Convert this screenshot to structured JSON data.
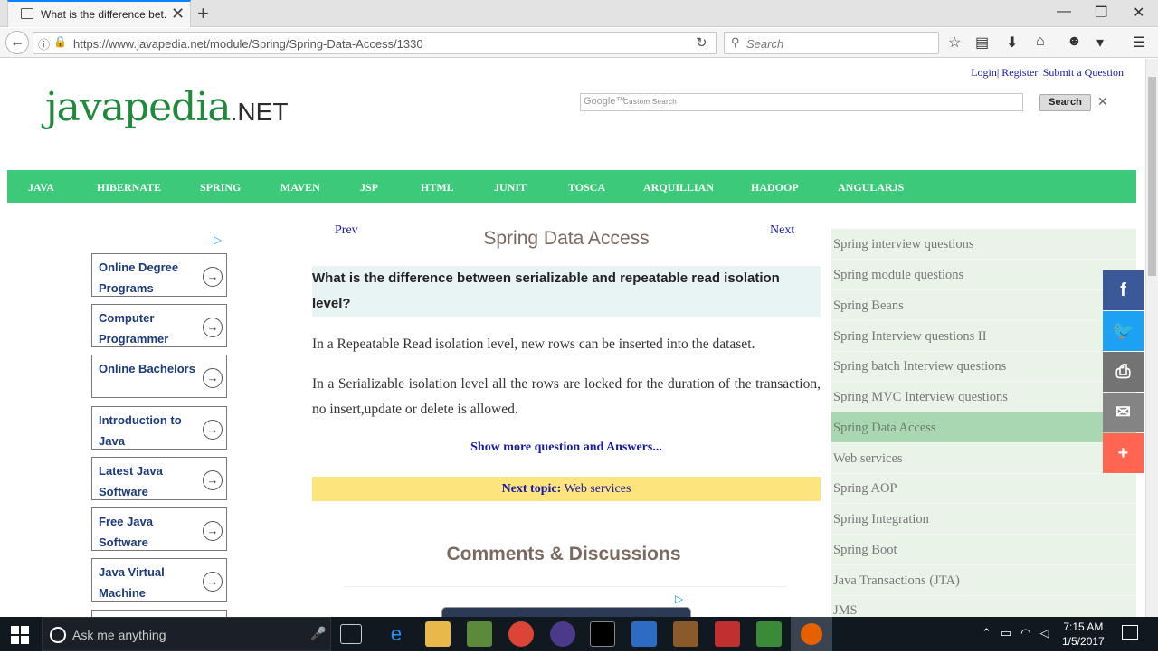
{
  "browser": {
    "tab_title": "What is the difference bet...",
    "url": "https://www.javapedia.net/module/Spring/Spring-Data-Access/1330",
    "search_placeholder": "Search"
  },
  "header": {
    "logo_main": "javapedia",
    "logo_suffix": ".NET",
    "links": "Login| Register| Submit a Question",
    "google_label": "Google™",
    "custom_search": "Custom Search",
    "search_button": "Search"
  },
  "nav": [
    "JAVA",
    "HIBERNATE",
    "SPRING",
    "MAVEN",
    "JSP",
    "HTML",
    "JUNIT",
    "TOSCA",
    "ARQUILLIAN",
    "HADOOP",
    "ANGULARJS"
  ],
  "ads": [
    {
      "label": "Online Degree Programs"
    },
    {
      "label": "Computer Programmer"
    },
    {
      "label": "Online Bachelors"
    },
    {
      "label": "Introduction to Java"
    },
    {
      "label": "Latest Java Software"
    },
    {
      "label": "Free Java Software"
    },
    {
      "label": "Java Virtual Machine"
    }
  ],
  "content": {
    "prev": "Prev",
    "next": "Next",
    "title": "Spring Data Access",
    "question": "What is the difference between serializable and repeatable read isolation level?",
    "para1": "In a Repeatable Read isolation level, new rows can be inserted into the dataset.",
    "para2": "In a Serializable isolation level all the rows are locked for the duration of the transaction, no insert,update or delete is allowed.",
    "show_more": "Show more question and Answers...",
    "next_topic_label": "Next topic:",
    "next_topic_value": "Web services",
    "comments_title": "Comments & Discussions"
  },
  "sidebar": [
    {
      "label": "Spring interview questions"
    },
    {
      "label": "Spring module questions"
    },
    {
      "label": "Spring Beans"
    },
    {
      "label": "Spring Interview questions II"
    },
    {
      "label": "Spring batch Interview questions"
    },
    {
      "label": "Spring MVC Interview questions"
    },
    {
      "label": "Spring Data Access",
      "active": true
    },
    {
      "label": "Web services"
    },
    {
      "label": "Spring AOP"
    },
    {
      "label": "Spring Integration"
    },
    {
      "label": "Spring Boot"
    },
    {
      "label": "Java Transactions (JTA)"
    },
    {
      "label": "JMS"
    }
  ],
  "share": [
    {
      "icon": "facebook-icon",
      "color": "#3b5998"
    },
    {
      "icon": "twitter-icon",
      "color": "#1da1f2"
    },
    {
      "icon": "print-icon",
      "color": "#737373"
    },
    {
      "icon": "email-icon",
      "color": "#848484"
    },
    {
      "icon": "plus-icon",
      "color": "#ff6550"
    }
  ],
  "taskbar": {
    "search_placeholder": "Ask me anything",
    "time": "7:15 AM",
    "date": "1/5/2017"
  }
}
